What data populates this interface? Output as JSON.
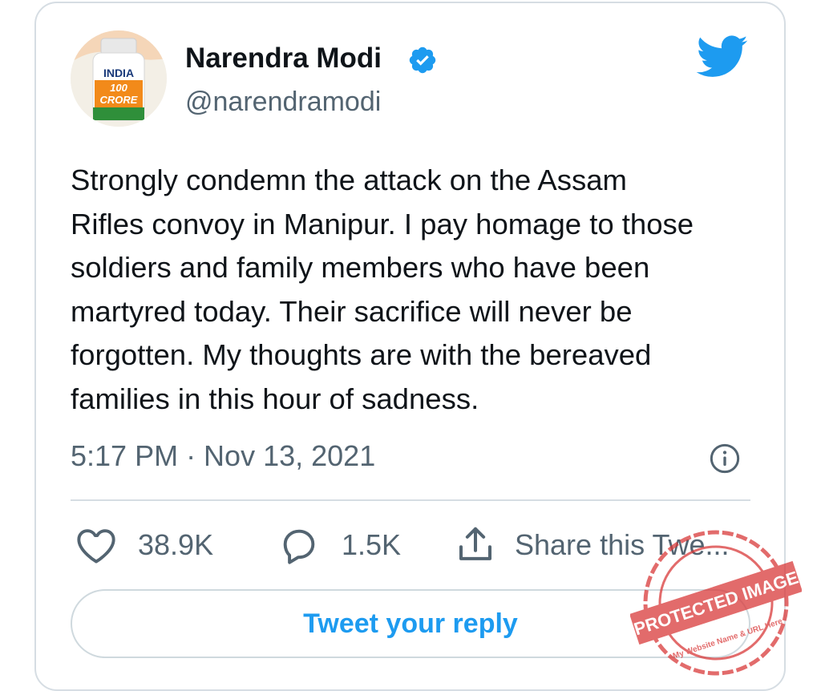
{
  "user": {
    "name": "Narendra Modi",
    "handle": "@narendramodi",
    "avatar_text": [
      "INDIA",
      "100",
      "CRORE"
    ]
  },
  "tweet": {
    "lines": [
      "Strongly condemn the attack on the Assam",
      "Rifles convoy in Manipur. I pay homage to those",
      "soldiers and family members who have been",
      "martyred today. Their sacrifice will never be",
      "forgotten. My thoughts are with the bereaved",
      "families in this hour of sadness."
    ],
    "timestamp": "5:17 PM · Nov 13, 2021"
  },
  "actions": {
    "likes": "38.9K",
    "replies": "1.5K",
    "share_label": "Share this Twe..."
  },
  "reply_button": "Tweet your reply",
  "watermark": {
    "main": "PROTECTED IMAGE",
    "sub": "My Website Name & URL Here"
  },
  "colors": {
    "accent": "#1d9bf0",
    "text": "#0f1419",
    "muted": "#536471",
    "border": "#d6dde3",
    "stamp": "#d93a3a"
  },
  "icons": [
    "verified-badge-icon",
    "twitter-bird-icon",
    "info-icon",
    "heart-icon",
    "reply-bubble-icon",
    "share-icon"
  ]
}
